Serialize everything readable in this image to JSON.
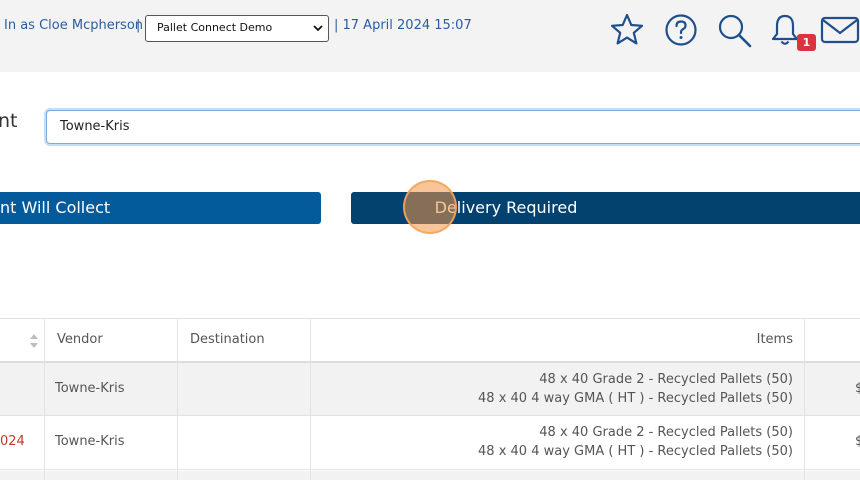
{
  "header": {
    "login_text": "In as Cloe Mcpherson",
    "sep1": "|",
    "org_select_value": "Pallet Connect Demo",
    "datetime": "| 17 April 2024 15:07",
    "notifications_count": "1",
    "icons": [
      "star-icon",
      "help-icon",
      "search-icon",
      "bell-icon",
      "mail-icon"
    ]
  },
  "form": {
    "client_label": "nt",
    "client_value": "Towne-Kris"
  },
  "buttons": {
    "collect_label": "nt Will Collect",
    "delivery_label": "Delivery Required"
  },
  "table": {
    "headers": {
      "vendor": "Vendor",
      "destination": "Destination",
      "items": "Items"
    },
    "rows": [
      {
        "date_fragment": "",
        "vendor": "Towne-Kris",
        "destination": "",
        "items": [
          "48 x 40 Grade 2 - Recycled Pallets (50)",
          "48 x 40 4 way GMA ( HT ) - Recycled Pallets (50)"
        ],
        "price_fragment": "$"
      },
      {
        "date_fragment": "024",
        "vendor": "Towne-Kris",
        "destination": "",
        "items": [
          "48 x 40 Grade 2 - Recycled Pallets (50)",
          "48 x 40 4 way GMA ( HT ) - Recycled Pallets (50)"
        ],
        "price_fragment": "$"
      }
    ]
  },
  "colors": {
    "link_blue": "#2a5d9f",
    "collect_button": "#035b9c",
    "delivery_button": "#03426f",
    "badge_red": "#d9343f",
    "date_red": "#c0392b"
  }
}
